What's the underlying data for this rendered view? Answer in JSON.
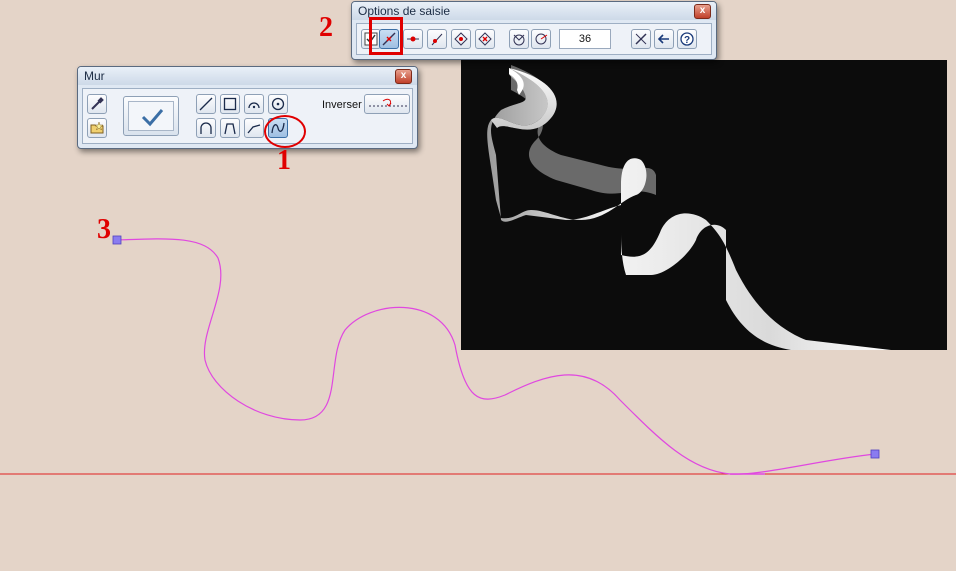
{
  "colors": {
    "background": "#e4d4c8",
    "curve": "#e048e0",
    "baseline": "#e02020",
    "annotation": "#e00000",
    "point": "#8a7cf0"
  },
  "options_window": {
    "title": "Options de saisie",
    "close": "x",
    "angle_value": "36",
    "buttons": [
      "checkbox-icon",
      "snap-endpoint-icon",
      "snap-midpoint-icon",
      "snap-perpendicular-icon",
      "snap-grid-icon",
      "snap-center-icon",
      "polar-icon",
      "angle-icon",
      "no-snap-icon",
      "back-arrow-icon",
      "help-icon"
    ]
  },
  "mur_window": {
    "title": "Mur",
    "close": "x",
    "inverser_label": "Inverser",
    "buttons": [
      "eyedropper-icon",
      "folder-star-icon",
      "validate-icon",
      "line-icon",
      "rectangle-icon",
      "arc-icon",
      "circle-icon",
      "arch-icon",
      "trapezoid-icon",
      "polyline-icon",
      "spline-icon",
      "inverser-icon"
    ]
  },
  "annotations": {
    "one": "1",
    "two": "2",
    "three": "3"
  },
  "preview": {
    "description_icon": "3d-wall-preview"
  }
}
